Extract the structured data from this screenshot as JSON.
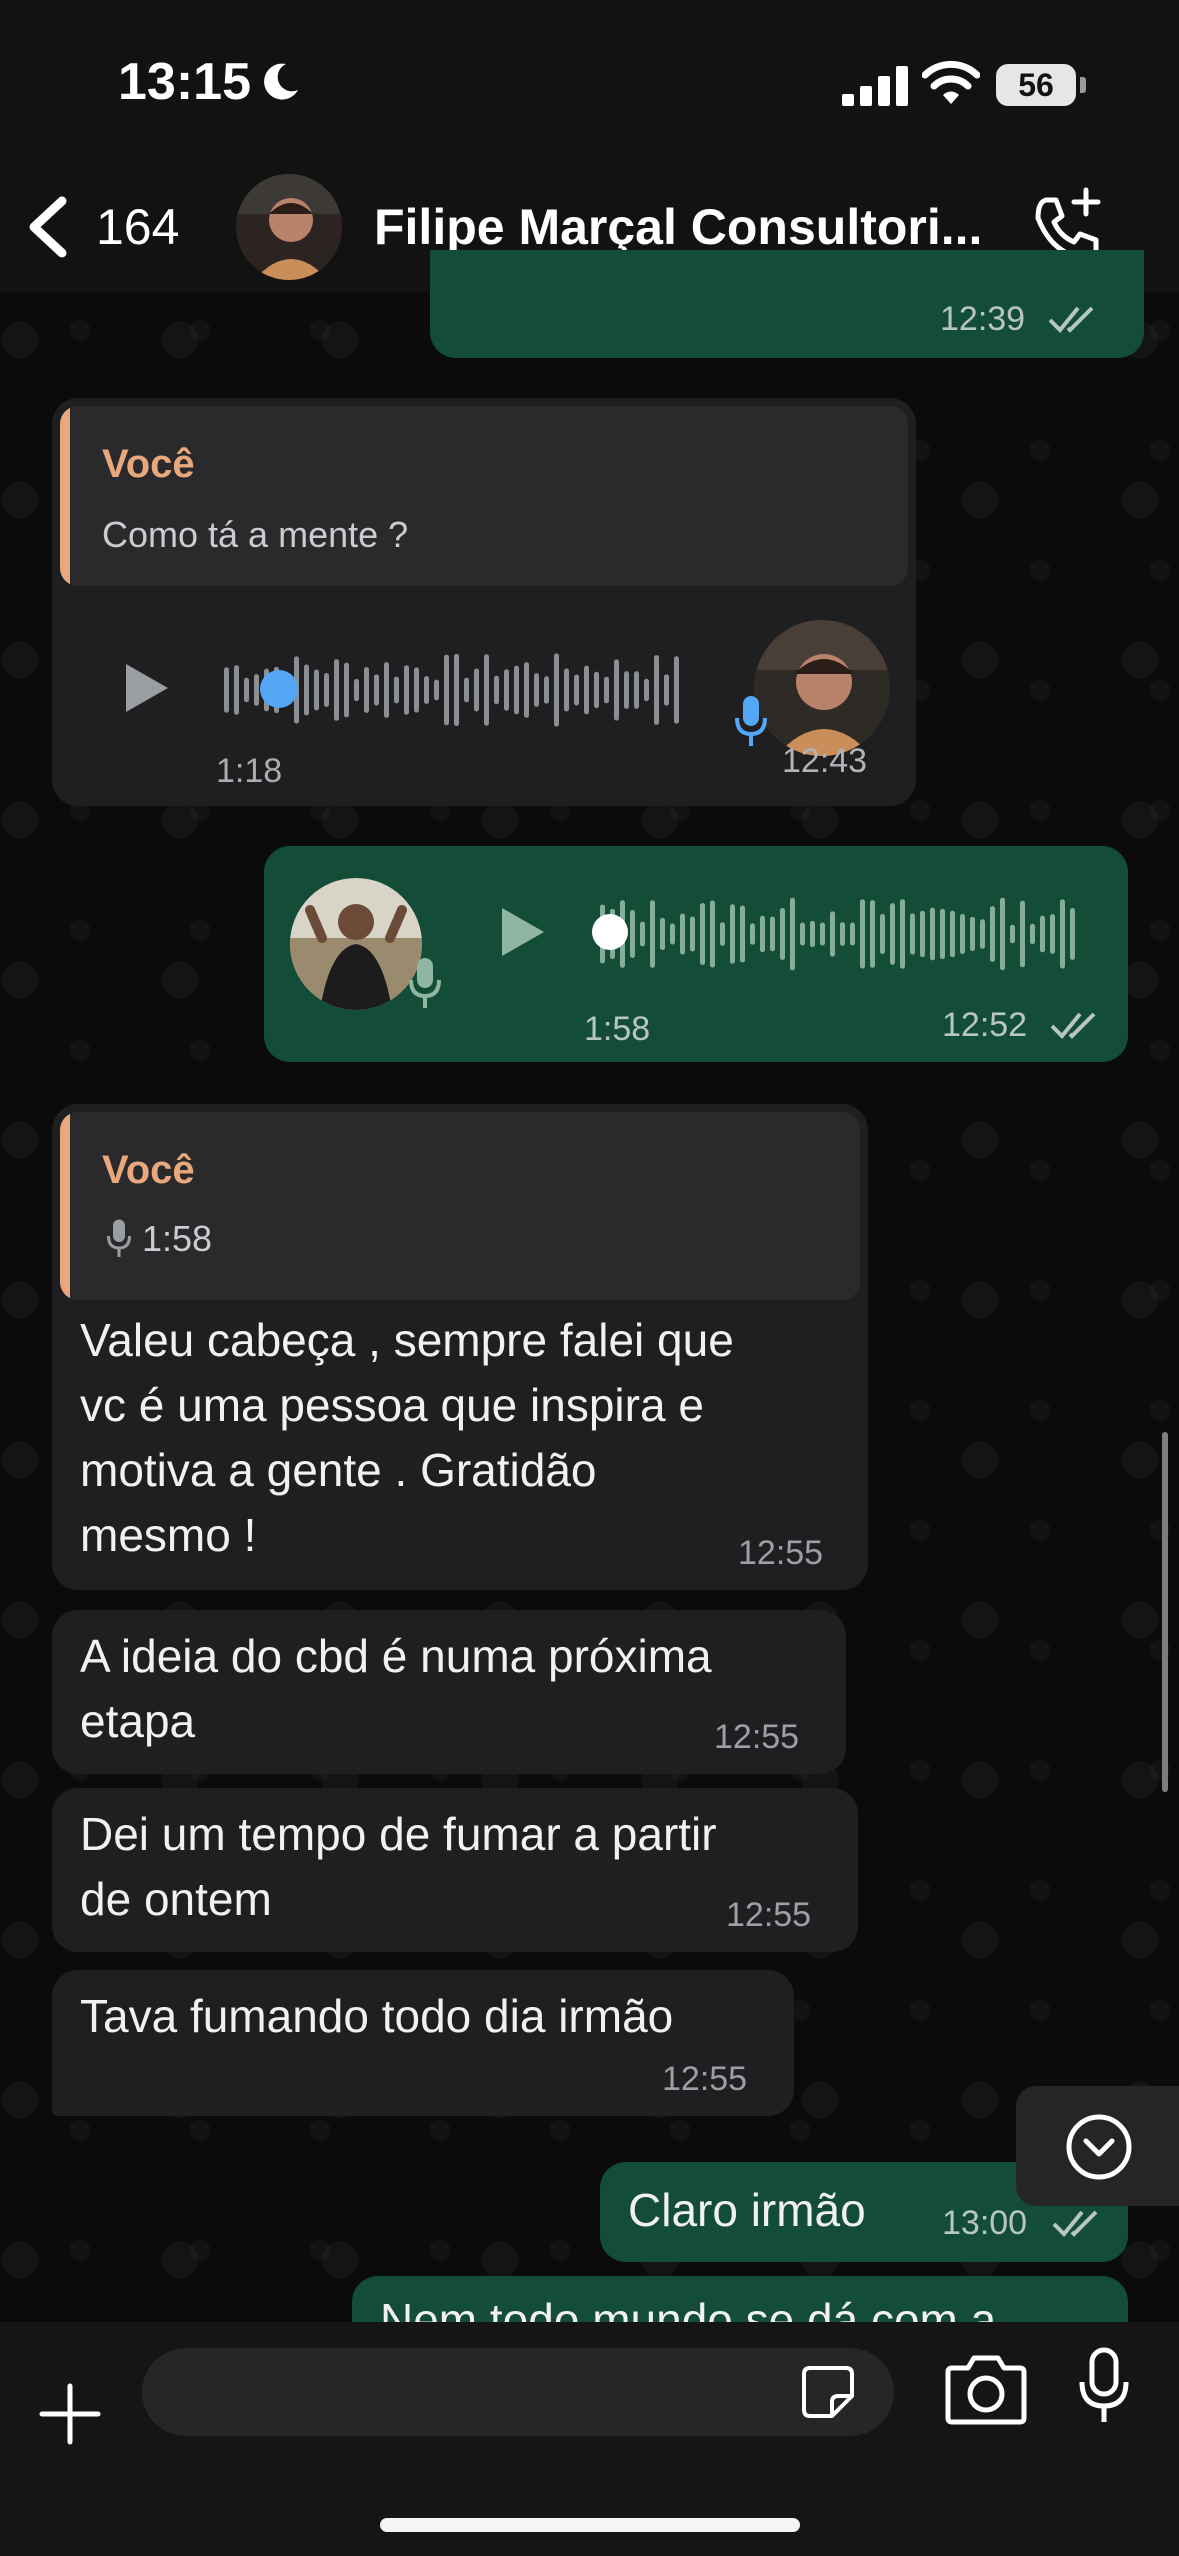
{
  "status_bar": {
    "time": "13:15",
    "battery": "56"
  },
  "header": {
    "back_count": "164",
    "title": "Filipe Marçal Consultori..."
  },
  "messages": {
    "m0": {
      "time": "12:39"
    },
    "m1": {
      "quote_author": "Você",
      "quote_text": "Como tá a mente ?",
      "duration": "1:18",
      "time": "12:43"
    },
    "m2": {
      "duration": "1:58",
      "time": "12:52"
    },
    "m3": {
      "quote_author": "Você",
      "quote_duration": "1:58",
      "lines": [
        "Valeu cabeça , sempre falei que",
        "vc é uma pessoa que inspira e",
        "motiva a gente . Gratidão",
        "mesmo !"
      ],
      "time": "12:55"
    },
    "m4": {
      "lines": [
        "A ideia do cbd é numa próxima",
        "etapa"
      ],
      "time": "12:55"
    },
    "m5": {
      "lines": [
        "Dei um tempo de fumar a partir",
        "de ontem"
      ],
      "time": "12:55"
    },
    "m6": {
      "lines": [
        "Tava fumando todo dia irmão"
      ],
      "time": "12:55"
    },
    "m7": {
      "text": "Claro irmão",
      "time": "13:00"
    },
    "m8": {
      "text_partial": "Nem todo mundo se dá com a"
    }
  },
  "composer": {
    "placeholder": ""
  },
  "colors": {
    "incoming": "#1f1f21",
    "outgoing": "#144d37",
    "quote_accent": "#e8a87c",
    "voice_dot": "#53a7f5"
  },
  "icons": [
    "back-chevron-icon",
    "call-add-icon",
    "play-icon",
    "mic-icon",
    "plus-icon",
    "sticker-icon",
    "camera-icon",
    "scroll-down-chevron-icon",
    "read-ticks-icon"
  ]
}
